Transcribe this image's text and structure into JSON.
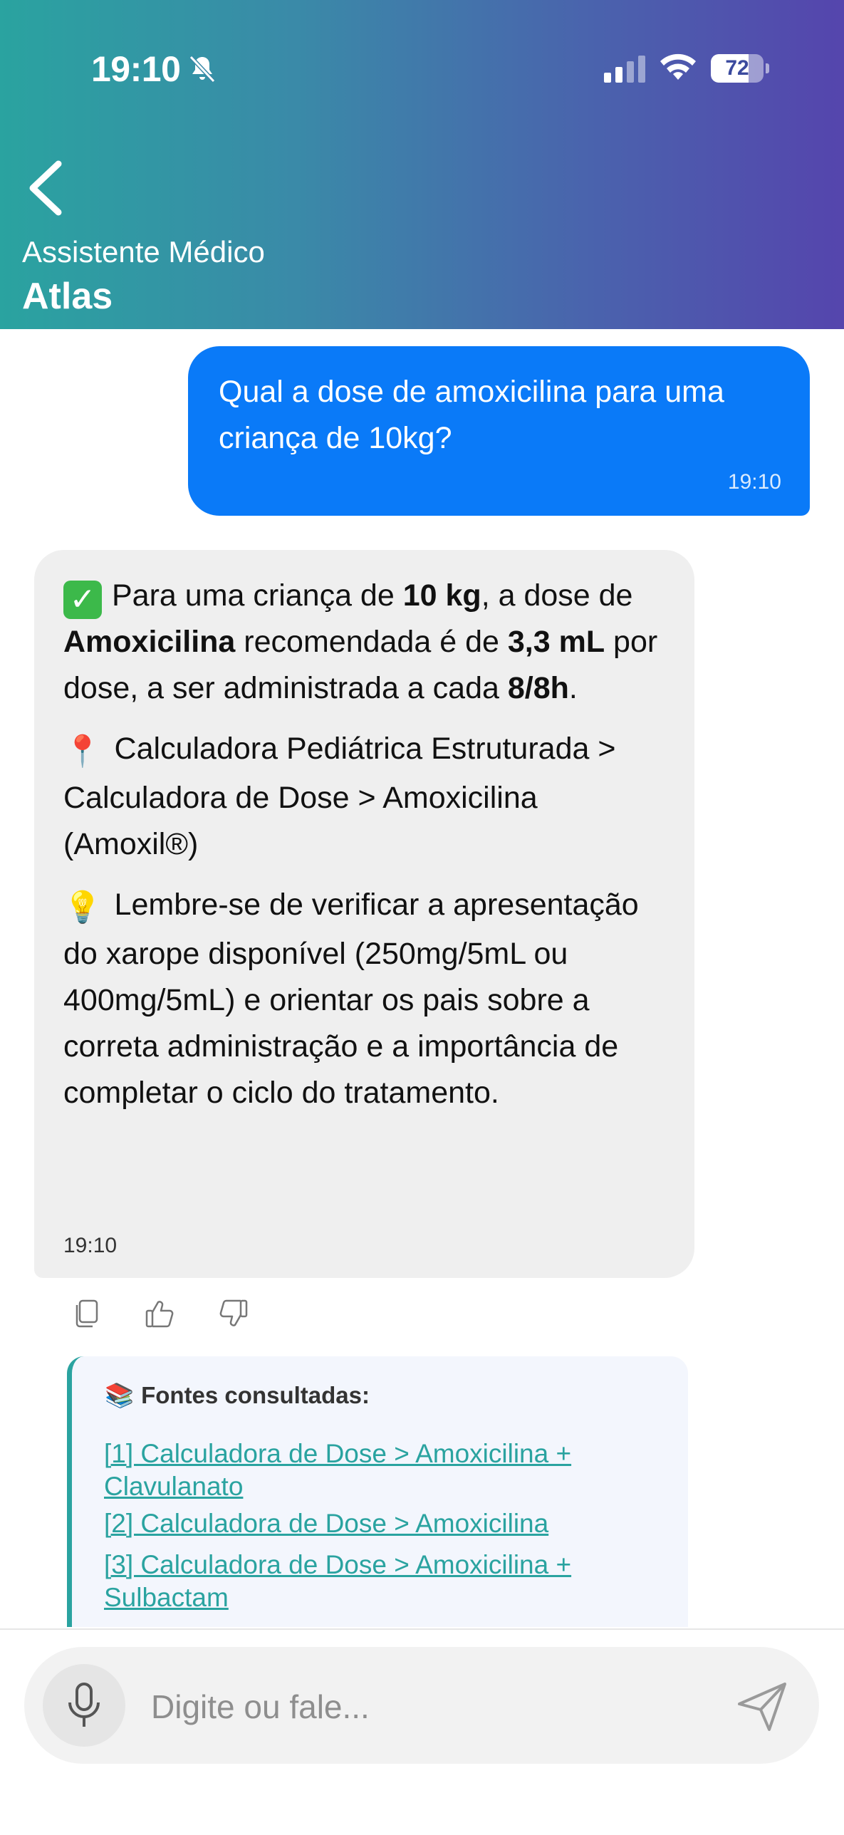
{
  "status_bar": {
    "time": "19:10",
    "battery": "72",
    "battery_level": 0.72,
    "icons": [
      "bell-slash-icon",
      "cellular-signal-icon",
      "wifi-icon",
      "battery-icon"
    ]
  },
  "header": {
    "back_icon": "chevron-left-icon",
    "subtitle": "Assistente Médico",
    "title": "Atlas",
    "gradient": [
      "#2aa3a0",
      "#5545ad"
    ]
  },
  "messages": {
    "user": {
      "text": "Qual a dose de amoxicilina para uma criança de 10kg?",
      "time": "19:10",
      "color": "#0a7af8"
    },
    "assistant": {
      "p1": {
        "t1": "Para uma criança de ",
        "b1": "10 kg",
        "t2": ", a dose de ",
        "b2": "Amoxicilina",
        "t3": " recomendada é de ",
        "b3": "3,3 mL",
        "t4": " por dose, a ser administrada a cada ",
        "b4": "8/8h",
        "t5": "."
      },
      "p2": "Calculadora Pediátrica Estruturada > Calculadora de Dose > Amoxicilina (Amoxil®)",
      "p3": "Lembre-se de verificar a apresentação do xarope disponível (250mg/5mL ou 400mg/5mL) e orientar os pais sobre a correta administração e a importância de completar o ciclo do tratamento.",
      "time": "19:10",
      "emojis": {
        "check": "✓",
        "pin": "📍",
        "bulb": "💡"
      }
    }
  },
  "actions": [
    "copy-icon",
    "thumbs-up-icon",
    "thumbs-down-icon"
  ],
  "sources": {
    "icon": "📚",
    "title": "Fontes consultadas:",
    "links": [
      "[1] Calculadora de Dose > Amoxicilina + Clavulanato",
      "[2] Calculadora de Dose > Amoxicilina",
      "[3] Calculadora de Dose > Amoxicilina + Sulbactam"
    ],
    "accent": "#2aa3a0"
  },
  "input": {
    "placeholder": "Digite ou fale...",
    "mic_icon": "microphone-icon",
    "send_icon": "send-icon"
  }
}
